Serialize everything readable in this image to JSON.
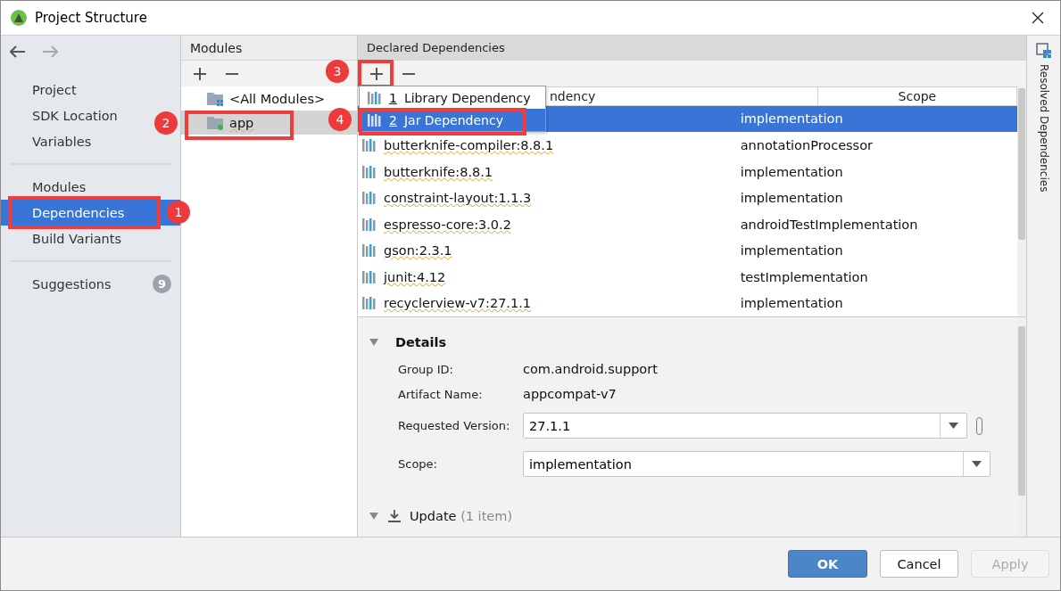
{
  "window": {
    "title": "Project Structure"
  },
  "sidebar": {
    "sections": [
      {
        "items": [
          {
            "label": "Project",
            "selected": false
          },
          {
            "label": "SDK Location",
            "selected": false
          },
          {
            "label": "Variables",
            "selected": false
          }
        ]
      },
      {
        "items": [
          {
            "label": "Modules",
            "selected": false
          },
          {
            "label": "Dependencies",
            "selected": true,
            "callout": "1"
          },
          {
            "label": "Build Variants",
            "selected": false
          }
        ]
      },
      {
        "items": [
          {
            "label": "Suggestions",
            "selected": false,
            "badge": "9"
          }
        ]
      }
    ]
  },
  "modules": {
    "title": "Modules",
    "items": [
      {
        "label": "<All Modules>",
        "kind": "all",
        "selected": false
      },
      {
        "label": "app",
        "kind": "module",
        "selected": true,
        "callout": "2"
      }
    ]
  },
  "dependencies": {
    "title": "Declared Dependencies",
    "add_callout": "3",
    "columns": [
      "ndency",
      "Scope"
    ],
    "rows": [
      {
        "scope": "implementation",
        "selected": true
      },
      {
        "name": "butterknife-compiler:8.8.1",
        "scope": "annotationProcessor",
        "selected": false
      },
      {
        "name": "butterknife:8.8.1",
        "scope": "implementation",
        "selected": false
      },
      {
        "name": "constraint-layout:1.1.3",
        "scope": "implementation",
        "selected": false
      },
      {
        "name": "espresso-core:3.0.2",
        "scope": "androidTestImplementation",
        "selected": false
      },
      {
        "name": "gson:2.3.1",
        "scope": "implementation",
        "selected": false
      },
      {
        "name": "junit:4.12",
        "scope": "testImplementation",
        "selected": false
      },
      {
        "name": "recyclerview-v7:27.1.1",
        "scope": "implementation",
        "selected": false
      }
    ],
    "popup": [
      {
        "mnemonic": "1",
        "label": "Library Dependency",
        "selected": false
      },
      {
        "mnemonic": "2",
        "label": "Jar Dependency",
        "selected": true,
        "callout": "4"
      }
    ]
  },
  "details": {
    "title": "Details",
    "fields": [
      {
        "kind": "text",
        "label": "Group ID:",
        "value": "com.android.support"
      },
      {
        "kind": "text",
        "label": "Artifact Name:",
        "value": "appcompat-v7"
      },
      {
        "kind": "combo",
        "label": "Requested Version:",
        "value": "27.1.1",
        "extra": true
      },
      {
        "kind": "combo",
        "label": "Scope:",
        "value": "implementation"
      }
    ],
    "update": {
      "label": "Update",
      "count": "(1 item)"
    }
  },
  "side_tab": "Resolved Dependencies",
  "buttons": [
    {
      "label": "OK",
      "kind": "primary",
      "disabled": false
    },
    {
      "label": "Cancel",
      "kind": "default",
      "disabled": false
    },
    {
      "label": "Apply",
      "kind": "default",
      "disabled": true
    }
  ]
}
